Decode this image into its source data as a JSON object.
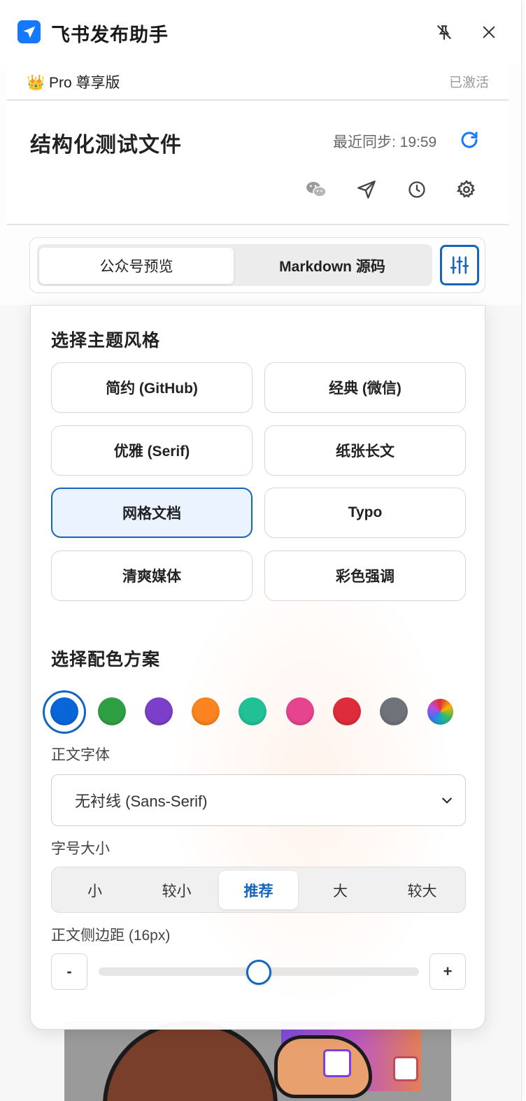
{
  "app": {
    "title": "飞书发布助手"
  },
  "pro": {
    "label": "👑 Pro 尊享版",
    "status": "已激活"
  },
  "document": {
    "title": "结构化测试文件",
    "sync_text": "最近同步: 19:59"
  },
  "toolbar": {
    "icons": [
      "wechat-icon",
      "send-icon",
      "history-icon",
      "gear-icon"
    ]
  },
  "tabs": [
    {
      "label": "公众号预览",
      "active": true
    },
    {
      "label": "Markdown 源码",
      "active": false
    }
  ],
  "theme": {
    "title": "选择主题风格",
    "options": [
      {
        "label": "简约 (GitHub)",
        "selected": false
      },
      {
        "label": "经典 (微信)",
        "selected": false
      },
      {
        "label": "优雅 (Serif)",
        "selected": false
      },
      {
        "label": "纸张长文",
        "selected": false
      },
      {
        "label": "网格文档",
        "selected": true
      },
      {
        "label": "Typo",
        "selected": false
      },
      {
        "label": "清爽媒体",
        "selected": false
      },
      {
        "label": "彩色强调",
        "selected": false
      }
    ]
  },
  "color_scheme": {
    "title": "选择配色方案",
    "swatches": [
      "#0a66d8",
      "#2ea043",
      "#7b3fc9",
      "#fb8320",
      "#22c195",
      "#e6448e",
      "#df2c3a",
      "#6e7379",
      "rainbow"
    ],
    "selected_index": 0
  },
  "font": {
    "label": "正文字体",
    "value": "无衬线 (Sans-Serif)"
  },
  "font_size": {
    "label": "字号大小",
    "options": [
      "小",
      "较小",
      "推荐",
      "大",
      "较大"
    ],
    "selected_index": 2
  },
  "margin": {
    "label": "正文侧边距 (16px)",
    "minus": "-",
    "plus": "+",
    "value_fraction": 0.5
  }
}
